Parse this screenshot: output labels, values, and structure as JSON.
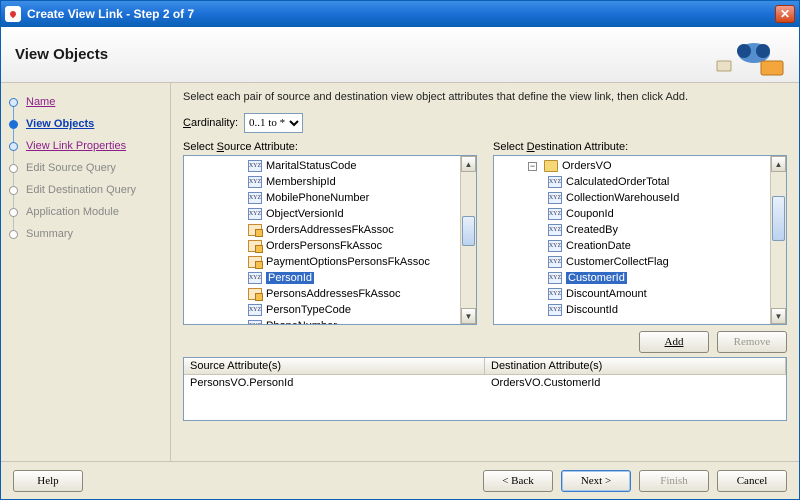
{
  "window": {
    "title": "Create View Link - Step 2 of 7"
  },
  "header": {
    "title": "View Objects"
  },
  "nav": {
    "items": [
      {
        "label": "Name",
        "state": "done"
      },
      {
        "label": "View Objects",
        "state": "current"
      },
      {
        "label": "View Link Properties",
        "state": "done"
      },
      {
        "label": "Edit Source Query",
        "state": "pending"
      },
      {
        "label": "Edit Destination Query",
        "state": "pending"
      },
      {
        "label": "Application Module",
        "state": "pending"
      },
      {
        "label": "Summary",
        "state": "pending"
      }
    ]
  },
  "main": {
    "instruction": "Select each pair of source and destination view object attributes that define the view link, then click Add.",
    "cardinality_label": "Cardinality:",
    "cardinality_value": "0..1 to *",
    "source_label": "Select Source Attribute:",
    "dest_label": "Select Destination Attribute:",
    "source_tree": [
      {
        "label": "MaritalStatusCode",
        "type": "xyz"
      },
      {
        "label": "MembershipId",
        "type": "xyz"
      },
      {
        "label": "MobilePhoneNumber",
        "type": "xyz"
      },
      {
        "label": "ObjectVersionId",
        "type": "xyz"
      },
      {
        "label": "OrdersAddressesFkAssoc",
        "type": "fk"
      },
      {
        "label": "OrdersPersonsFkAssoc",
        "type": "fk"
      },
      {
        "label": "PaymentOptionsPersonsFkAssoc",
        "type": "fk"
      },
      {
        "label": "PersonId",
        "type": "xyz",
        "selected": true
      },
      {
        "label": "PersonsAddressesFkAssoc",
        "type": "fk"
      },
      {
        "label": "PersonTypeCode",
        "type": "xyz"
      },
      {
        "label": "PhoneNumber",
        "type": "xyz"
      }
    ],
    "dest_tree_root": "OrdersVO",
    "dest_tree": [
      {
        "label": "CalculatedOrderTotal",
        "type": "xyz"
      },
      {
        "label": "CollectionWarehouseId",
        "type": "xyz"
      },
      {
        "label": "CouponId",
        "type": "xyz"
      },
      {
        "label": "CreatedBy",
        "type": "xyz"
      },
      {
        "label": "CreationDate",
        "type": "xyz"
      },
      {
        "label": "CustomerCollectFlag",
        "type": "xyz"
      },
      {
        "label": "CustomerId",
        "type": "xyz",
        "selected": true
      },
      {
        "label": "DiscountAmount",
        "type": "xyz"
      },
      {
        "label": "DiscountId",
        "type": "xyz"
      }
    ],
    "add_label": "Add",
    "remove_label": "Remove",
    "grid": {
      "col1": "Source Attribute(s)",
      "col2": "Destination Attribute(s)",
      "row1_c1": "PersonsVO.PersonId",
      "row1_c2": "OrdersVO.CustomerId"
    }
  },
  "footer": {
    "help": "Help",
    "back": "< Back",
    "next": "Next >",
    "finish": "Finish",
    "cancel": "Cancel"
  }
}
